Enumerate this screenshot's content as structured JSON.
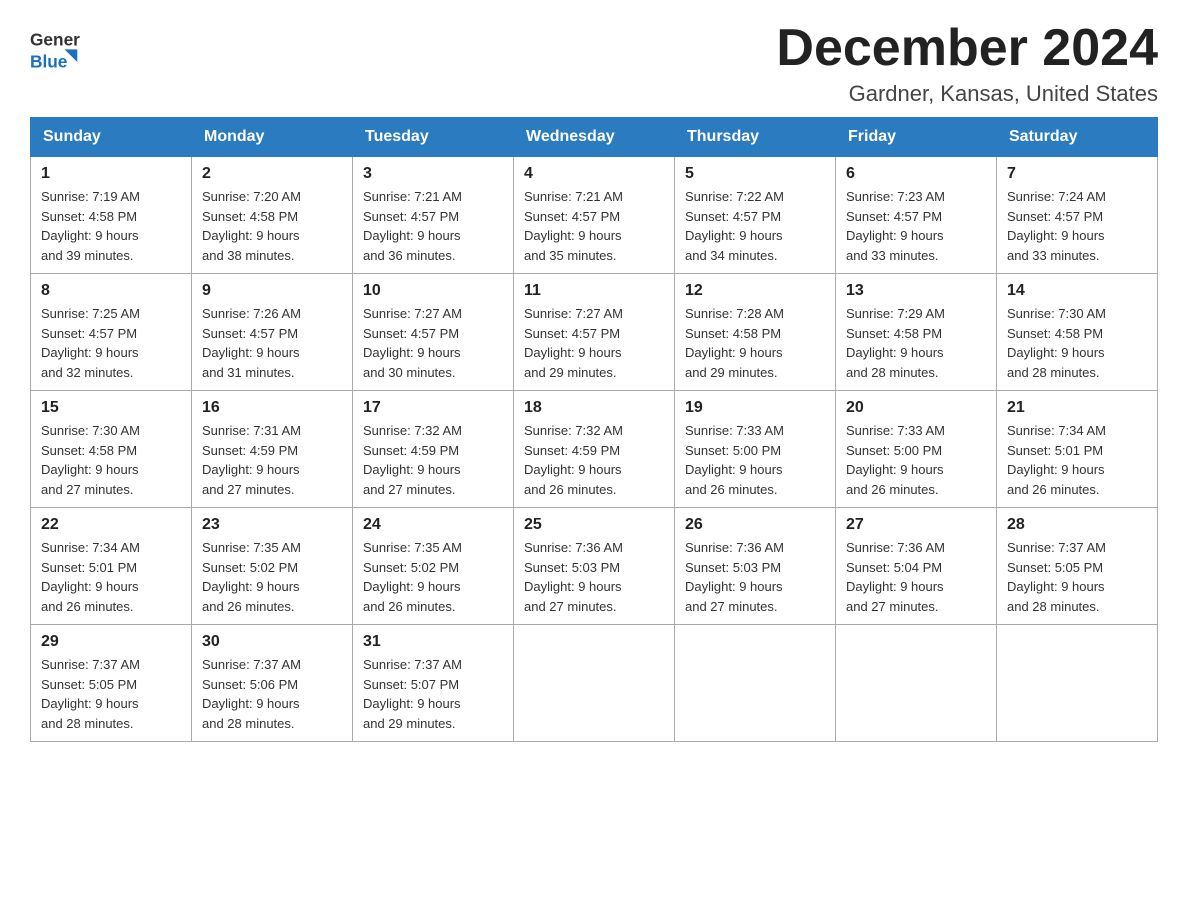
{
  "header": {
    "logo_line1": "General",
    "logo_line2": "Blue",
    "month_title": "December 2024",
    "location": "Gardner, Kansas, United States"
  },
  "weekdays": [
    "Sunday",
    "Monday",
    "Tuesday",
    "Wednesday",
    "Thursday",
    "Friday",
    "Saturday"
  ],
  "weeks": [
    [
      {
        "day": "1",
        "sunrise": "7:19 AM",
        "sunset": "4:58 PM",
        "daylight": "9 hours and 39 minutes."
      },
      {
        "day": "2",
        "sunrise": "7:20 AM",
        "sunset": "4:58 PM",
        "daylight": "9 hours and 38 minutes."
      },
      {
        "day": "3",
        "sunrise": "7:21 AM",
        "sunset": "4:57 PM",
        "daylight": "9 hours and 36 minutes."
      },
      {
        "day": "4",
        "sunrise": "7:21 AM",
        "sunset": "4:57 PM",
        "daylight": "9 hours and 35 minutes."
      },
      {
        "day": "5",
        "sunrise": "7:22 AM",
        "sunset": "4:57 PM",
        "daylight": "9 hours and 34 minutes."
      },
      {
        "day": "6",
        "sunrise": "7:23 AM",
        "sunset": "4:57 PM",
        "daylight": "9 hours and 33 minutes."
      },
      {
        "day": "7",
        "sunrise": "7:24 AM",
        "sunset": "4:57 PM",
        "daylight": "9 hours and 33 minutes."
      }
    ],
    [
      {
        "day": "8",
        "sunrise": "7:25 AM",
        "sunset": "4:57 PM",
        "daylight": "9 hours and 32 minutes."
      },
      {
        "day": "9",
        "sunrise": "7:26 AM",
        "sunset": "4:57 PM",
        "daylight": "9 hours and 31 minutes."
      },
      {
        "day": "10",
        "sunrise": "7:27 AM",
        "sunset": "4:57 PM",
        "daylight": "9 hours and 30 minutes."
      },
      {
        "day": "11",
        "sunrise": "7:27 AM",
        "sunset": "4:57 PM",
        "daylight": "9 hours and 29 minutes."
      },
      {
        "day": "12",
        "sunrise": "7:28 AM",
        "sunset": "4:58 PM",
        "daylight": "9 hours and 29 minutes."
      },
      {
        "day": "13",
        "sunrise": "7:29 AM",
        "sunset": "4:58 PM",
        "daylight": "9 hours and 28 minutes."
      },
      {
        "day": "14",
        "sunrise": "7:30 AM",
        "sunset": "4:58 PM",
        "daylight": "9 hours and 28 minutes."
      }
    ],
    [
      {
        "day": "15",
        "sunrise": "7:30 AM",
        "sunset": "4:58 PM",
        "daylight": "9 hours and 27 minutes."
      },
      {
        "day": "16",
        "sunrise": "7:31 AM",
        "sunset": "4:59 PM",
        "daylight": "9 hours and 27 minutes."
      },
      {
        "day": "17",
        "sunrise": "7:32 AM",
        "sunset": "4:59 PM",
        "daylight": "9 hours and 27 minutes."
      },
      {
        "day": "18",
        "sunrise": "7:32 AM",
        "sunset": "4:59 PM",
        "daylight": "9 hours and 26 minutes."
      },
      {
        "day": "19",
        "sunrise": "7:33 AM",
        "sunset": "5:00 PM",
        "daylight": "9 hours and 26 minutes."
      },
      {
        "day": "20",
        "sunrise": "7:33 AM",
        "sunset": "5:00 PM",
        "daylight": "9 hours and 26 minutes."
      },
      {
        "day": "21",
        "sunrise": "7:34 AM",
        "sunset": "5:01 PM",
        "daylight": "9 hours and 26 minutes."
      }
    ],
    [
      {
        "day": "22",
        "sunrise": "7:34 AM",
        "sunset": "5:01 PM",
        "daylight": "9 hours and 26 minutes."
      },
      {
        "day": "23",
        "sunrise": "7:35 AM",
        "sunset": "5:02 PM",
        "daylight": "9 hours and 26 minutes."
      },
      {
        "day": "24",
        "sunrise": "7:35 AM",
        "sunset": "5:02 PM",
        "daylight": "9 hours and 26 minutes."
      },
      {
        "day": "25",
        "sunrise": "7:36 AM",
        "sunset": "5:03 PM",
        "daylight": "9 hours and 27 minutes."
      },
      {
        "day": "26",
        "sunrise": "7:36 AM",
        "sunset": "5:03 PM",
        "daylight": "9 hours and 27 minutes."
      },
      {
        "day": "27",
        "sunrise": "7:36 AM",
        "sunset": "5:04 PM",
        "daylight": "9 hours and 27 minutes."
      },
      {
        "day": "28",
        "sunrise": "7:37 AM",
        "sunset": "5:05 PM",
        "daylight": "9 hours and 28 minutes."
      }
    ],
    [
      {
        "day": "29",
        "sunrise": "7:37 AM",
        "sunset": "5:05 PM",
        "daylight": "9 hours and 28 minutes."
      },
      {
        "day": "30",
        "sunrise": "7:37 AM",
        "sunset": "5:06 PM",
        "daylight": "9 hours and 28 minutes."
      },
      {
        "day": "31",
        "sunrise": "7:37 AM",
        "sunset": "5:07 PM",
        "daylight": "9 hours and 29 minutes."
      },
      null,
      null,
      null,
      null
    ]
  ],
  "labels": {
    "sunrise": "Sunrise:",
    "sunset": "Sunset:",
    "daylight": "Daylight:"
  }
}
